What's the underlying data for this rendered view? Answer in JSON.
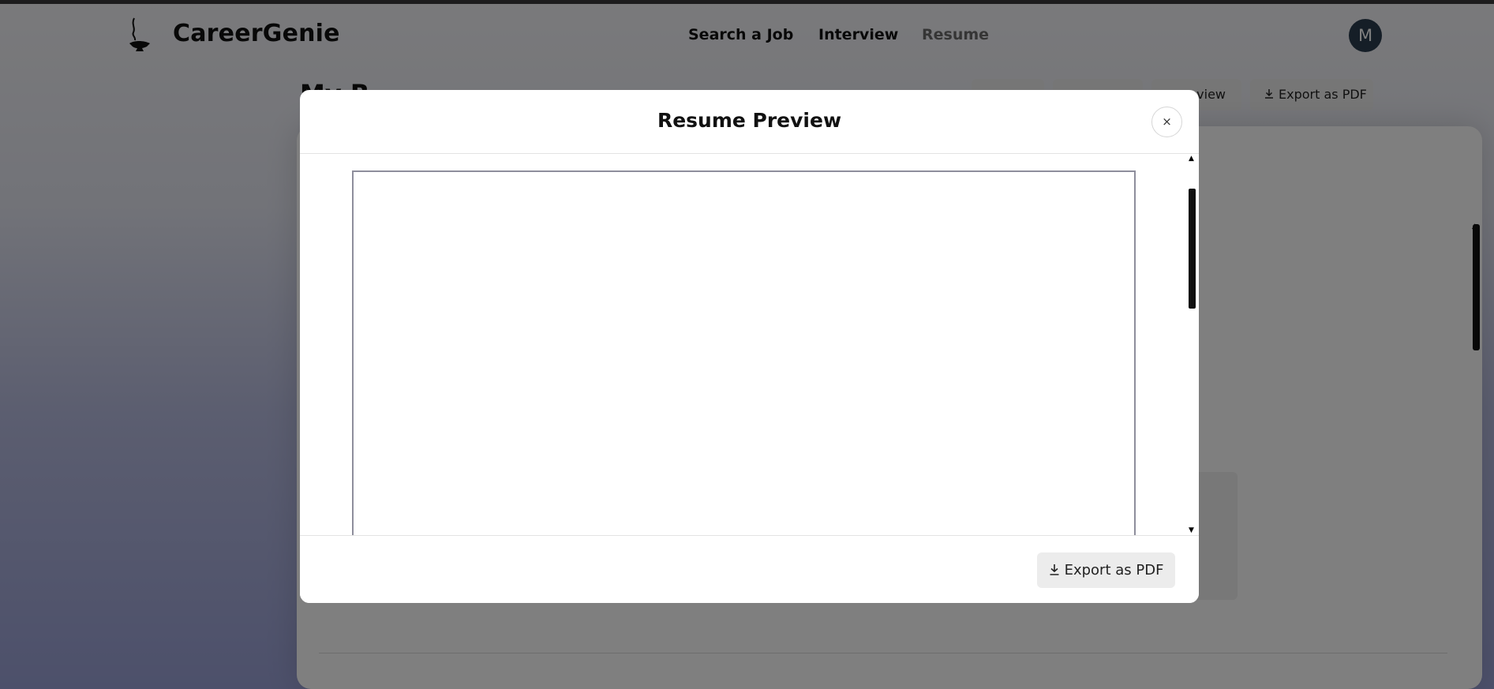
{
  "header": {
    "brand": "CareerGenie",
    "logo_icon": "genie-lamp-icon",
    "nav": [
      "Search a Job",
      "Interview",
      "Resume"
    ],
    "active_nav": "Resume",
    "avatar_initial": "M"
  },
  "page": {
    "title": "My R",
    "toolbar": [
      "",
      "",
      "eview",
      "Export as PDF"
    ]
  },
  "modal": {
    "title": "Resume Preview",
    "close_label": "×",
    "export_label": "Export as PDF",
    "export_icon": "download-icon"
  },
  "colors": {
    "avatar_bg": "#2a3d4e",
    "overlay": "rgba(0,0,0,0.5)",
    "button_bg": "#ececec"
  }
}
